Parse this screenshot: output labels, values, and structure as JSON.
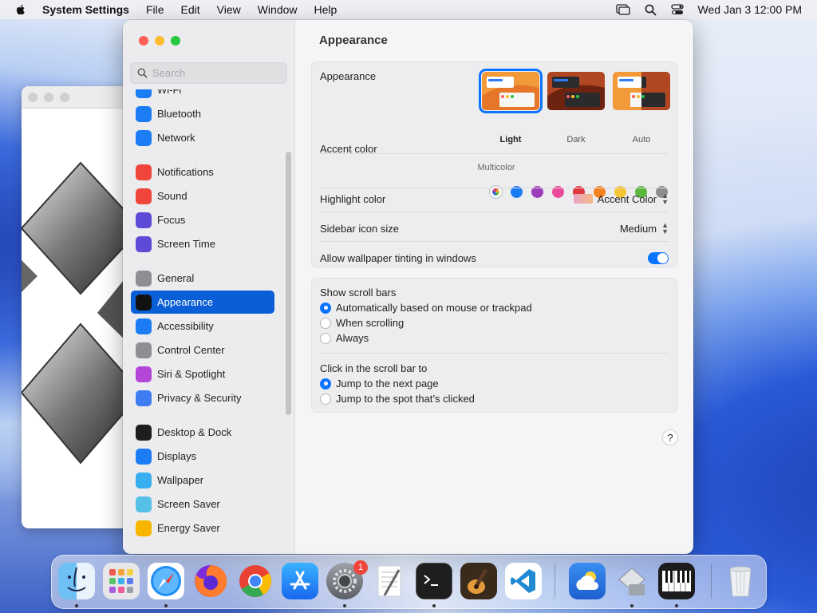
{
  "menubar": {
    "app": "System Settings",
    "items": [
      "File",
      "Edit",
      "View",
      "Window",
      "Help"
    ],
    "clock": "Wed Jan 3  12:00 PM"
  },
  "search": {
    "placeholder": "Search"
  },
  "sidebar": {
    "items": [
      {
        "label": "Wi-Fi",
        "icon": "wifi-icon",
        "color": "#1c7cf4"
      },
      {
        "label": "Bluetooth",
        "icon": "bluetooth-icon",
        "color": "#1c7cf4"
      },
      {
        "label": "Network",
        "icon": "network-icon",
        "color": "#1c7cf4"
      },
      {
        "label": "Notifications",
        "icon": "notifications-icon",
        "color": "#f0453a"
      },
      {
        "label": "Sound",
        "icon": "sound-icon",
        "color": "#f0453a"
      },
      {
        "label": "Focus",
        "icon": "focus-icon",
        "color": "#5d4bd8"
      },
      {
        "label": "Screen Time",
        "icon": "screen-time-icon",
        "color": "#5d4bd8"
      },
      {
        "label": "General",
        "icon": "gear-icon",
        "color": "#8e8e93"
      },
      {
        "label": "Appearance",
        "icon": "appearance-icon",
        "color": "#1d1d1f",
        "selected": true
      },
      {
        "label": "Accessibility",
        "icon": "accessibility-icon",
        "color": "#1c7cf4"
      },
      {
        "label": "Control Center",
        "icon": "control-center-icon",
        "color": "#8e8e93"
      },
      {
        "label": "Siri & Spotlight",
        "icon": "siri-icon",
        "color": "#b347d9"
      },
      {
        "label": "Privacy & Security",
        "icon": "hand-icon",
        "color": "#3f7ef2"
      },
      {
        "label": "Desktop & Dock",
        "icon": "desktop-dock-icon",
        "color": "#1d1d1f"
      },
      {
        "label": "Displays",
        "icon": "displays-icon",
        "color": "#1c7cf4"
      },
      {
        "label": "Wallpaper",
        "icon": "wallpaper-icon",
        "color": "#36aef0"
      },
      {
        "label": "Screen Saver",
        "icon": "screen-saver-icon",
        "color": "#57c0e8"
      },
      {
        "label": "Energy Saver",
        "icon": "energy-saver-icon",
        "color": "#f7b500"
      }
    ]
  },
  "content": {
    "title": "Appearance",
    "appearance": {
      "label": "Appearance",
      "options": [
        "Light",
        "Dark",
        "Auto"
      ],
      "selected": "Light"
    },
    "accent": {
      "label": "Accent color",
      "colors": [
        "multicolor",
        "#1a7cf5",
        "#9b3db8",
        "#ea4c9a",
        "#e0383e",
        "#f6821f",
        "#f7c433",
        "#5ab73d",
        "#8c8c8c"
      ],
      "selected_label": "Multicolor"
    },
    "highlight": {
      "label": "Highlight color",
      "value": "Accent Color"
    },
    "icon_size": {
      "label": "Sidebar icon size",
      "value": "Medium"
    },
    "tinting": {
      "label": "Allow wallpaper tinting in windows",
      "enabled": true
    },
    "scrollbars": {
      "label": "Show scroll bars",
      "options": [
        "Automatically based on mouse or trackpad",
        "When scrolling",
        "Always"
      ],
      "selected": 0
    },
    "click": {
      "label": "Click in the scroll bar to",
      "options": [
        "Jump to the next page",
        "Jump to the spot that’s clicked"
      ],
      "selected": 0
    },
    "help": "?"
  },
  "dock": {
    "badge": "1",
    "apps": [
      "finder-icon",
      "launchpad-icon",
      "safari-icon",
      "firefox-icon",
      "chrome-icon",
      "app-store-icon",
      "system-settings-icon",
      "textedit-icon",
      "terminal-icon",
      "garageband-icon",
      "vscode-icon",
      "weather-icon",
      "migration-assistant-icon",
      "piano-icon",
      "trash-icon"
    ]
  }
}
